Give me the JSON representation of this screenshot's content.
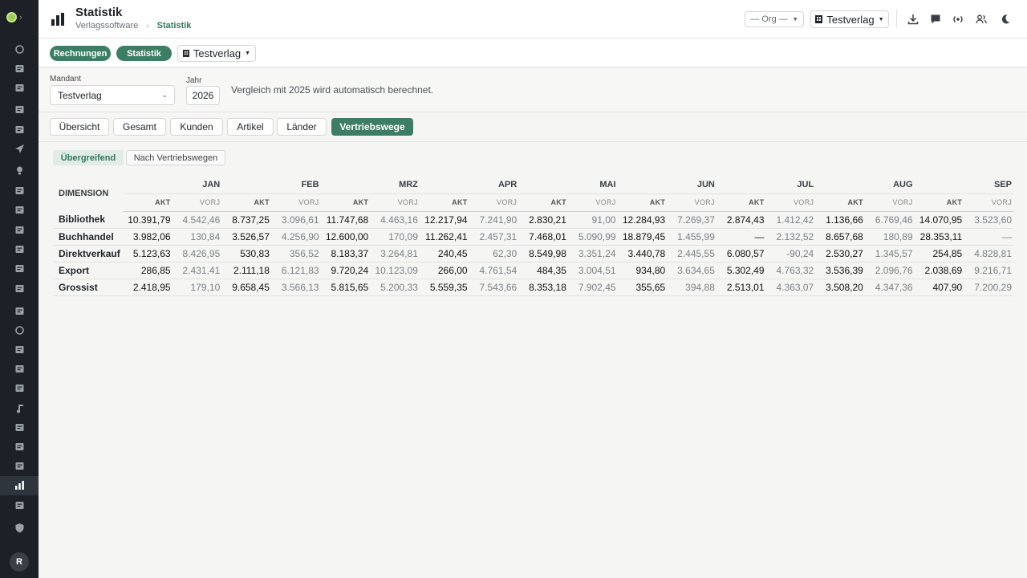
{
  "header": {
    "title": "Statistik",
    "breadcrumb": [
      "Verlagssoftware",
      "Statistik"
    ],
    "org_select": "— Org —",
    "verlag_select": "Testverlag"
  },
  "toolbar": {
    "rechnungen": "Rechnungen",
    "statistik": "Statistik",
    "verlag_select": "Testverlag"
  },
  "filters": {
    "mandant_label": "Mandant",
    "mandant_value": "Testverlag",
    "jahr_label": "Jahr",
    "jahr_value": "2026",
    "hint": "Vergleich mit 2025 wird automatisch berechnet."
  },
  "tabs": [
    "Übersicht",
    "Gesamt",
    "Kunden",
    "Artikel",
    "Länder",
    "Vertriebswege"
  ],
  "active_tab": "Vertriebswege",
  "subtabs": [
    "Übergreifend",
    "Nach Vertriebswegen"
  ],
  "table": {
    "dimension_header": "DIMENSION",
    "akt_label": "AKT",
    "vorj_label": "VORJ",
    "months": [
      "JAN",
      "FEB",
      "MRZ",
      "APR",
      "MAI",
      "JUN",
      "JUL",
      "AUG",
      "SEP"
    ],
    "rows": [
      {
        "label": "Bibliothek",
        "cells": [
          [
            "10.391,79",
            "4.542,46"
          ],
          [
            "8.737,25",
            "3.096,61"
          ],
          [
            "11.747,68",
            "4.463,16"
          ],
          [
            "12.217,94",
            "7.241,90"
          ],
          [
            "2.830,21",
            "91,00"
          ],
          [
            "12.284,93",
            "7.269,37"
          ],
          [
            "2.874,43",
            "1.412,42"
          ],
          [
            "1.136,66",
            "6.769,46"
          ],
          [
            "14.070,95",
            "3.523,60"
          ]
        ]
      },
      {
        "label": "Buchhandel",
        "cells": [
          [
            "3.982,06",
            "130,84"
          ],
          [
            "3.526,57",
            "4.256,90"
          ],
          [
            "12.600,00",
            "170,09"
          ],
          [
            "11.262,41",
            "2.457,31"
          ],
          [
            "7.468,01",
            "5.090,99"
          ],
          [
            "18.879,45",
            "1.455,99"
          ],
          [
            "—",
            "2.132,52"
          ],
          [
            "8.657,68",
            "180,89"
          ],
          [
            "28.353,11",
            "—"
          ]
        ]
      },
      {
        "label": "Direktverkauf",
        "cells": [
          [
            "5.123,63",
            "8.426,95"
          ],
          [
            "530,83",
            "356,52"
          ],
          [
            "8.183,37",
            "3.264,81"
          ],
          [
            "240,45",
            "62,30"
          ],
          [
            "8.549,98",
            "3.351,24"
          ],
          [
            "3.440,78",
            "2.445,55"
          ],
          [
            "6.080,57",
            "-90,24"
          ],
          [
            "2.530,27",
            "1.345,57"
          ],
          [
            "254,85",
            "4.828,81"
          ]
        ]
      },
      {
        "label": "Export",
        "cells": [
          [
            "286,85",
            "2.431,41"
          ],
          [
            "2.111,18",
            "6.121,83"
          ],
          [
            "9.720,24",
            "10.123,09"
          ],
          [
            "266,00",
            "4.761,54"
          ],
          [
            "484,35",
            "3.004,51"
          ],
          [
            "934,80",
            "3.634,65"
          ],
          [
            "5.302,49",
            "4.763,32"
          ],
          [
            "3.536,39",
            "2.096,76"
          ],
          [
            "2.038,69",
            "9.216,71"
          ]
        ]
      },
      {
        "label": "Grossist",
        "cells": [
          [
            "2.418,95",
            "179,10"
          ],
          [
            "9.658,45",
            "3.566,13"
          ],
          [
            "5.815,65",
            "5.200,33"
          ],
          [
            "5.559,35",
            "7.543,66"
          ],
          [
            "8.353,18",
            "7.902,45"
          ],
          [
            "355,65",
            "394,88"
          ],
          [
            "2.513,01",
            "4.363,07"
          ],
          [
            "3.508,20",
            "4.347,36"
          ],
          [
            "407,90",
            "7.200,29"
          ]
        ]
      }
    ]
  },
  "user": {
    "avatar_initial": "R"
  },
  "colors": {
    "accent": "#3d7d64",
    "sidebar": "#1d2127"
  }
}
